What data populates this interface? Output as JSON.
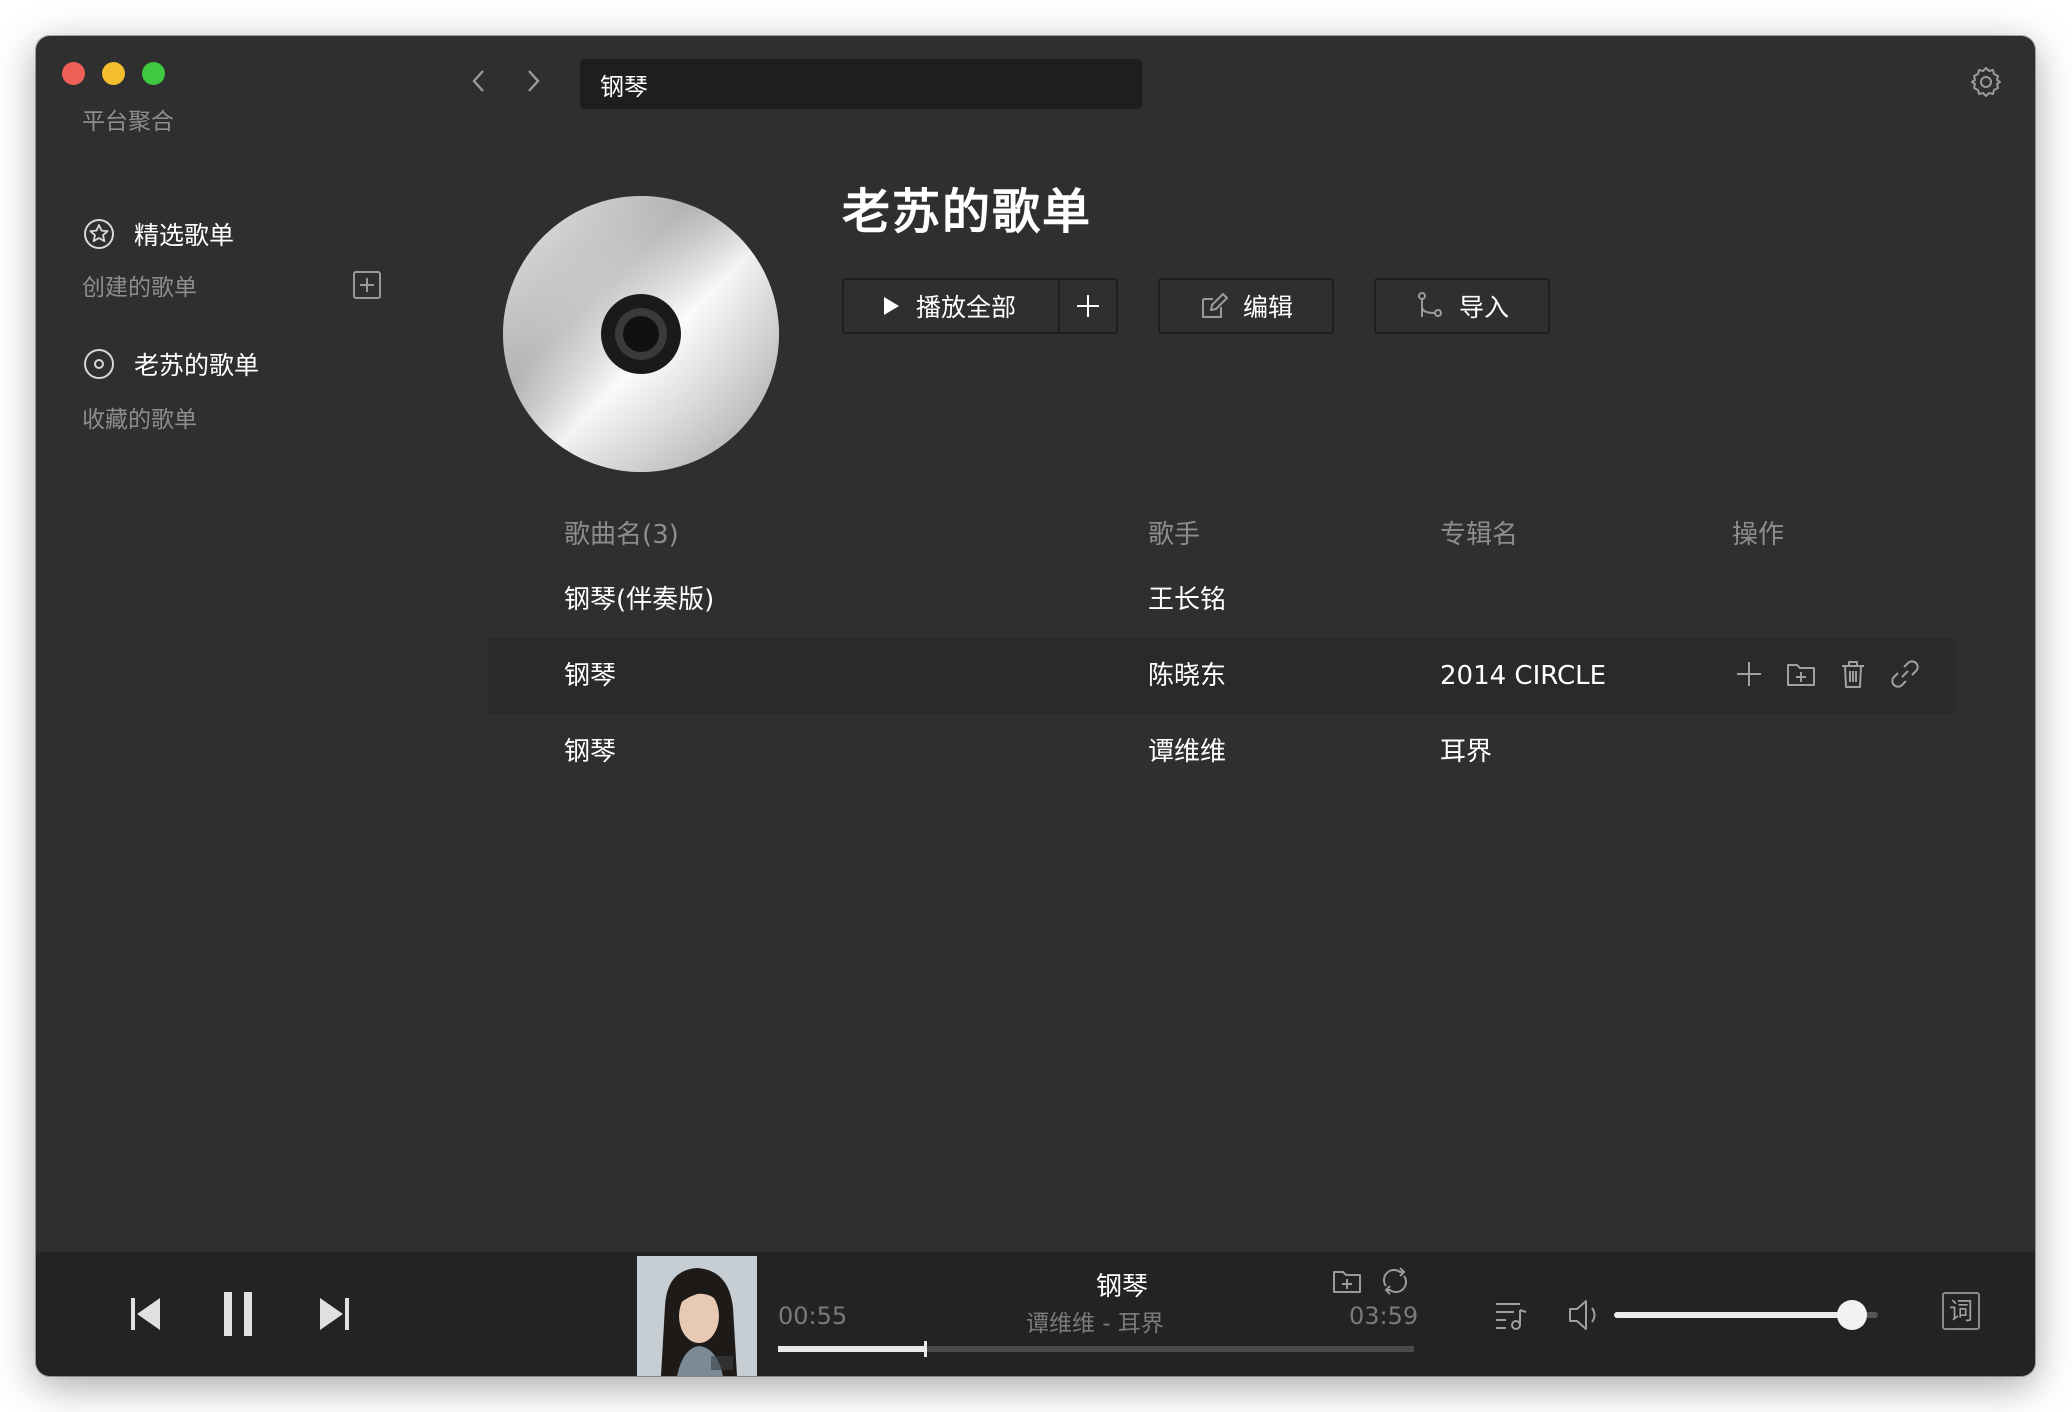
{
  "search": {
    "value": "钢琴"
  },
  "sidebar": {
    "section_platform": "平台聚合",
    "item_featured": "精选歌单",
    "section_created": "创建的歌单",
    "item_playlist": "老苏的歌单",
    "section_favorites": "收藏的歌单"
  },
  "playlist": {
    "title": "老苏的歌单",
    "play_all": "播放全部",
    "edit": "编辑",
    "import": "导入"
  },
  "table": {
    "headers": {
      "song": "歌曲名(3)",
      "artist": "歌手",
      "album": "专辑名",
      "actions": "操作"
    },
    "rows": [
      {
        "song": "钢琴(伴奏版)",
        "artist": "王长铭",
        "album": ""
      },
      {
        "song": "钢琴",
        "artist": "陈晓东",
        "album": "2014 CIRCLE"
      },
      {
        "song": "钢琴",
        "artist": "谭维维",
        "album": "耳界"
      }
    ]
  },
  "player": {
    "title": "钢琴",
    "subtitle": "谭维维 - 耳界",
    "elapsed": "00:55",
    "duration": "03:59",
    "progress": 0.23,
    "volume": 0.9,
    "lyric_label": "词"
  },
  "colors": {
    "window_bg": "#2f2f2f",
    "player_bg": "#232323",
    "search_bg": "#1e1e1e",
    "highlight_row": "#2a2a2a"
  }
}
